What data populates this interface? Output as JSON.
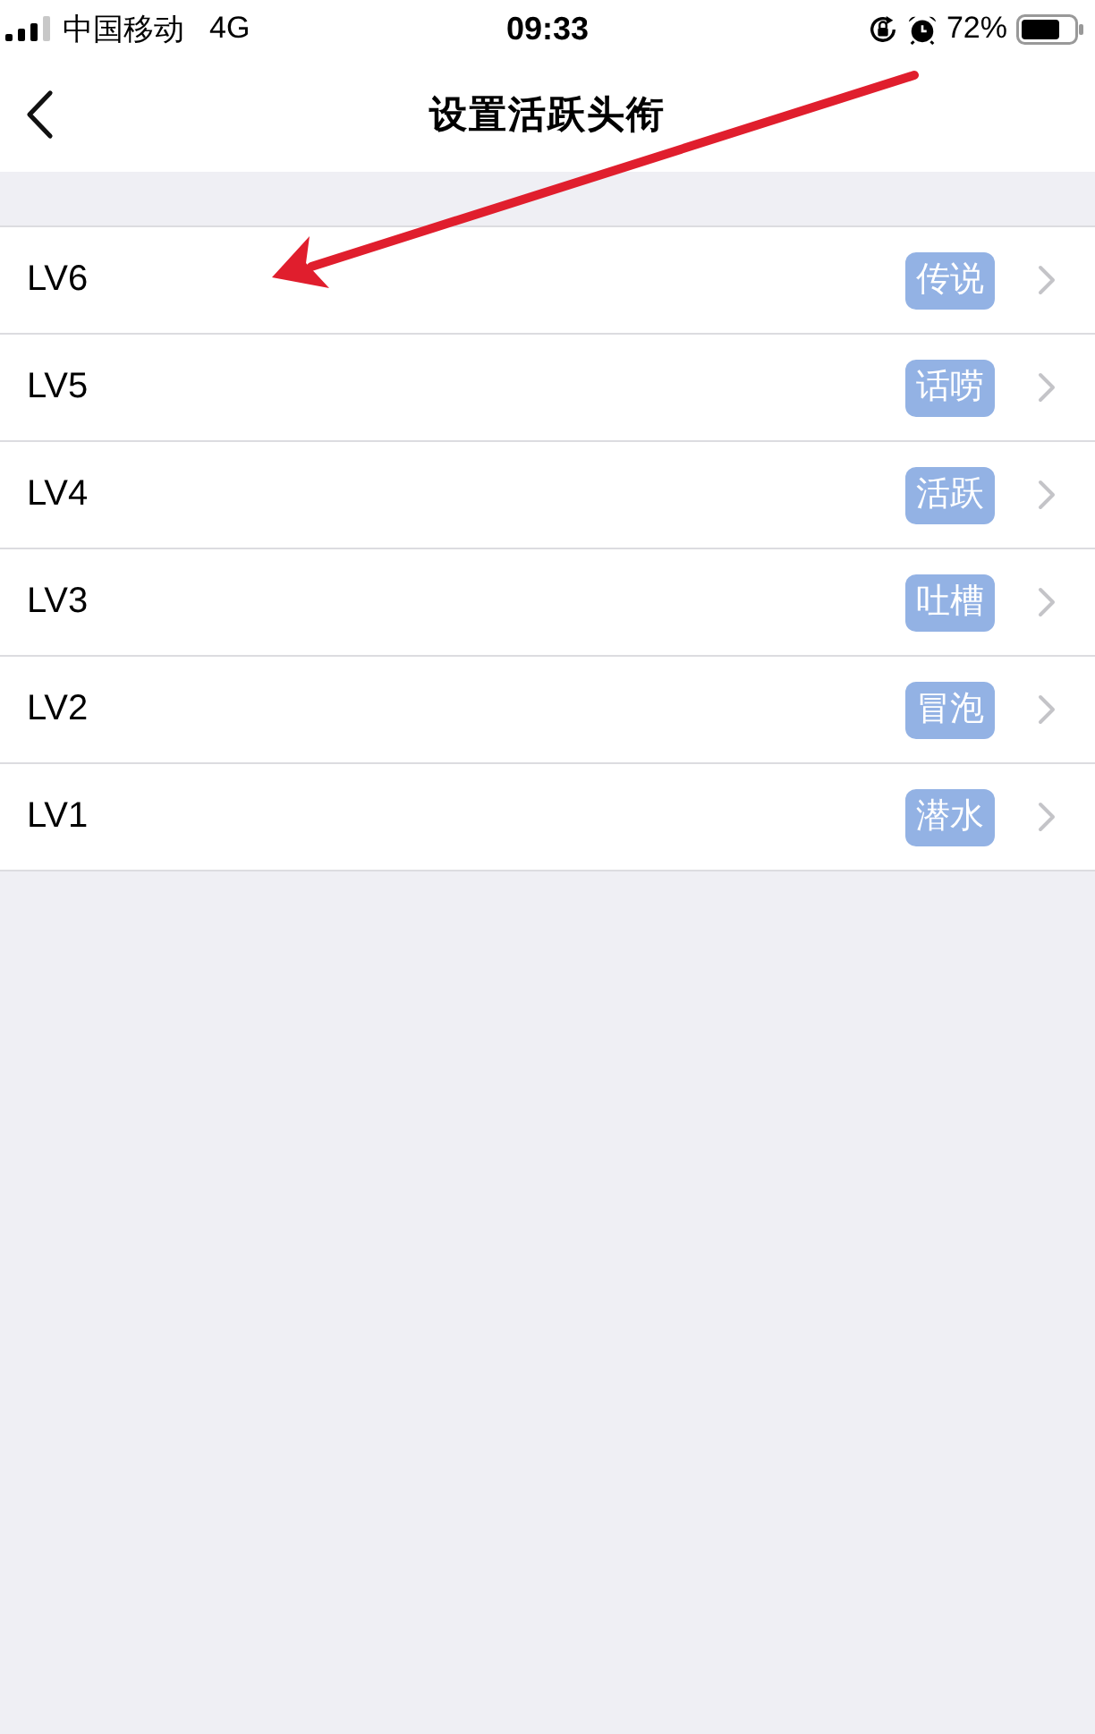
{
  "status_bar": {
    "carrier": "中国移动",
    "network": "4G",
    "time": "09:33",
    "battery": "72%"
  },
  "nav_bar": {
    "title": "设置活跃头衔"
  },
  "rows": [
    {
      "name": "LV6",
      "badge": "传说"
    },
    {
      "name": "LV5",
      "badge": "话唠"
    },
    {
      "name": "LV4",
      "badge": "活跃"
    },
    {
      "name": "LV3",
      "badge": "吐槽"
    },
    {
      "name": "LV2",
      "badge": "冒泡"
    },
    {
      "name": "LV1",
      "badge": "潜水"
    }
  ]
}
